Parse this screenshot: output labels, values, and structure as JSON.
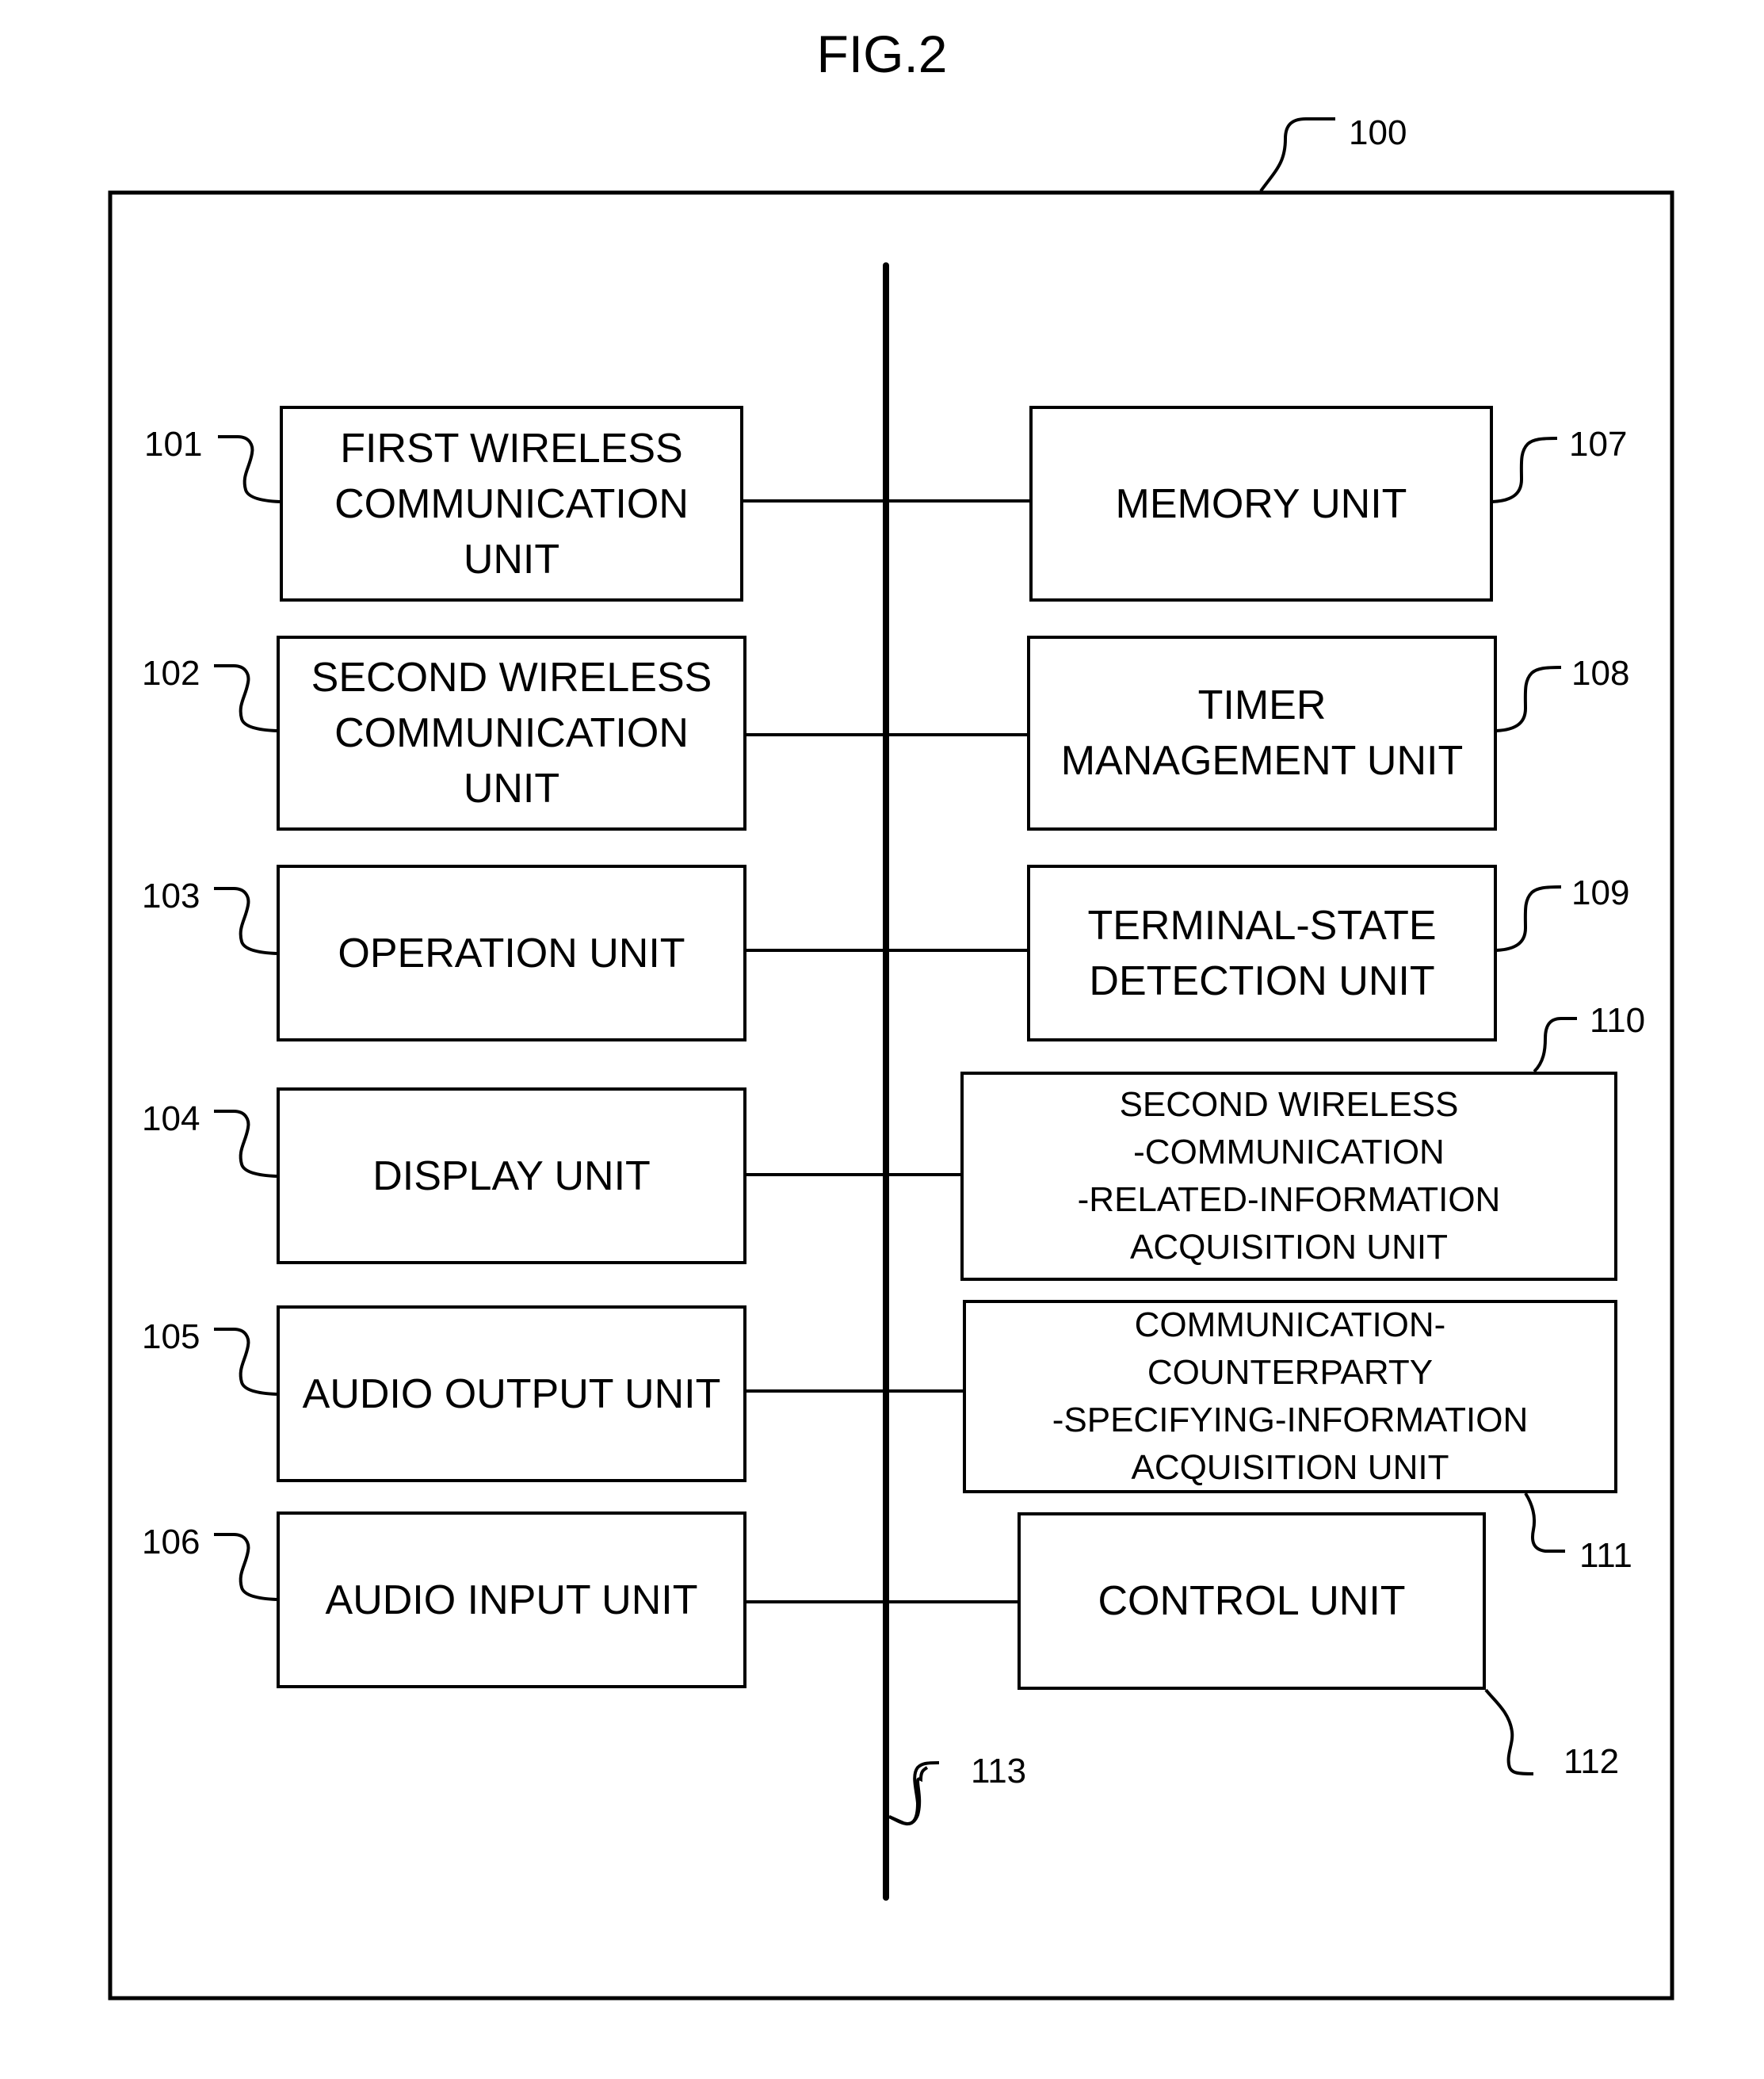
{
  "figure": {
    "title": "FIG.2"
  },
  "device": {
    "ref": "100"
  },
  "bus": {
    "ref": "113"
  },
  "blocks": {
    "b101": {
      "ref": "101",
      "lines": [
        "FIRST WIRELESS",
        "COMMUNICATION",
        "UNIT"
      ]
    },
    "b102": {
      "ref": "102",
      "lines": [
        "SECOND WIRELESS",
        "COMMUNICATION",
        "UNIT"
      ]
    },
    "b103": {
      "ref": "103",
      "lines": [
        "OPERATION UNIT"
      ]
    },
    "b104": {
      "ref": "104",
      "lines": [
        "DISPLAY UNIT"
      ]
    },
    "b105": {
      "ref": "105",
      "lines": [
        "AUDIO OUTPUT UNIT"
      ]
    },
    "b106": {
      "ref": "106",
      "lines": [
        "AUDIO INPUT UNIT"
      ]
    },
    "b107": {
      "ref": "107",
      "lines": [
        "MEMORY UNIT"
      ]
    },
    "b108": {
      "ref": "108",
      "lines": [
        "TIMER",
        "MANAGEMENT UNIT"
      ]
    },
    "b109": {
      "ref": "109",
      "lines": [
        "TERMINAL-STATE",
        "DETECTION UNIT"
      ]
    },
    "b110": {
      "ref": "110",
      "lines": [
        "SECOND WIRELESS",
        "-COMMUNICATION",
        "-RELATED-INFORMATION",
        "ACQUISITION UNIT"
      ]
    },
    "b111": {
      "ref": "111",
      "lines": [
        "COMMUNICATION-",
        "COUNTERPARTY",
        "-SPECIFYING-INFORMATION",
        "ACQUISITION UNIT"
      ]
    },
    "b112": {
      "ref": "112",
      "lines": [
        "CONTROL UNIT"
      ]
    }
  }
}
